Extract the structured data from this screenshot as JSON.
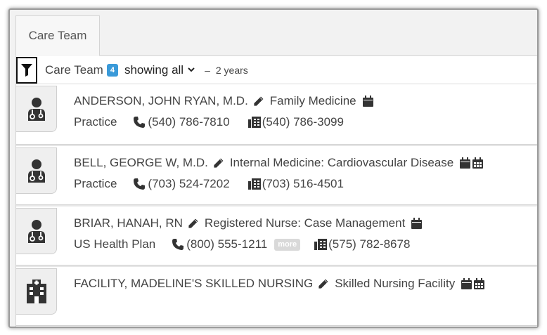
{
  "tab": {
    "label": "Care Team"
  },
  "filterbar": {
    "title": "Care Team",
    "count": "4",
    "showing": "showing all",
    "dash": "–",
    "range": "2 years"
  },
  "members": [
    {
      "name": "ANDERSON, JOHN RYAN, M.D.",
      "specialty": "Family Medicine",
      "org": "Practice",
      "phone": "(540) 786-7810",
      "fax": "(540) 786-3099"
    },
    {
      "name": "BELL, GEORGE W, M.D.",
      "specialty": "Internal Medicine: Cardiovascular Disease",
      "org": "Practice",
      "phone": "(703) 524-7202",
      "fax": "(703) 516-4501"
    },
    {
      "name": "BRIAR, HANAH, RN",
      "specialty": "Registered Nurse: Case Management",
      "org": "US Health Plan",
      "phone": "(800) 555-1211",
      "more": "more",
      "fax": "(575) 782-8678"
    },
    {
      "name": "FACILITY, MADELINE'S SKILLED NURSING",
      "specialty": "Skilled Nursing Facility"
    }
  ],
  "colors": {
    "badge": "#3a9ad9",
    "icon": "#333333",
    "more": "#d9d9d9"
  }
}
